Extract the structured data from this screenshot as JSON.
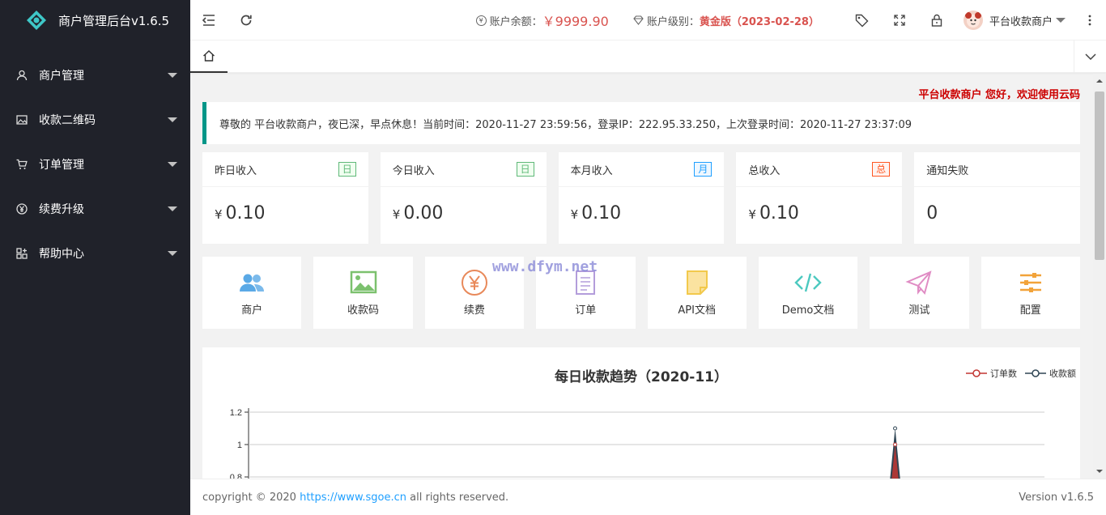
{
  "app": {
    "title": "商户管理后台v1.6.5"
  },
  "sidebar": {
    "items": [
      {
        "label": "商户管理",
        "icon": "user-icon"
      },
      {
        "label": "收款二维码",
        "icon": "image-icon"
      },
      {
        "label": "订单管理",
        "icon": "cart-icon"
      },
      {
        "label": "续费升级",
        "icon": "yen-icon"
      },
      {
        "label": "帮助中心",
        "icon": "apps-icon"
      }
    ]
  },
  "header": {
    "balance_label": "账户余额：",
    "balance_value": "￥9999.90",
    "level_label": "账户级别：",
    "level_value": "黄金版（2023-02-28）",
    "username": "平台收款商户"
  },
  "notice": {
    "marquee": "平台收款商户 您好，欢迎使用云码",
    "text": "尊敬的 平台收款商户，夜已深，早点休息！当前时间：2020-11-27 23:59:56，登录IP：222.95.33.250，上次登录时间：2020-11-27 23:37:09"
  },
  "stats": [
    {
      "title": "昨日收入",
      "badge": "日",
      "badge_color": "#5FB878",
      "currency": "¥",
      "value": "0.10"
    },
    {
      "title": "今日收入",
      "badge": "日",
      "badge_color": "#5FB878",
      "currency": "¥",
      "value": "0.00"
    },
    {
      "title": "本月收入",
      "badge": "月",
      "badge_color": "#1E9FFF",
      "currency": "¥",
      "value": "0.10"
    },
    {
      "title": "总收入",
      "badge": "总",
      "badge_color": "#FF5722",
      "currency": "¥",
      "value": "0.10"
    },
    {
      "title": "通知失败",
      "badge": "",
      "currency": "",
      "value": "0"
    }
  ],
  "shortcuts": [
    {
      "label": "商户",
      "icon": "users-icon",
      "color": "#5aa9e6"
    },
    {
      "label": "收款码",
      "icon": "picture-icon",
      "color": "#7cc16e"
    },
    {
      "label": "续费",
      "icon": "yen-circle-icon",
      "color": "#e8895a"
    },
    {
      "label": "订单",
      "icon": "document-icon",
      "color": "#b39ddb"
    },
    {
      "label": "API文档",
      "icon": "note-icon",
      "color": "#f2c94c"
    },
    {
      "label": "Demo文档",
      "icon": "code-icon",
      "color": "#4cc9c0"
    },
    {
      "label": "测试",
      "icon": "paper-plane-icon",
      "color": "#e08cc4"
    },
    {
      "label": "配置",
      "icon": "sliders-icon",
      "color": "#f2a33a"
    }
  ],
  "watermark": "www.dfym.net",
  "chart_data": {
    "type": "line",
    "title": "每日收款趋势（2020-11）",
    "xlabel": "",
    "ylabel": "",
    "ylim": [
      0.8,
      1.2
    ],
    "y_ticks": [
      "1.2",
      "1",
      "0.8"
    ],
    "series": [
      {
        "name": "订单数",
        "color": "#c23531",
        "peak_day": 27,
        "peak_value": 1
      },
      {
        "name": "收款额",
        "color": "#2f4554",
        "peak_day": 27,
        "peak_value": 1.1
      }
    ],
    "grid": true,
    "legend": "top-right"
  },
  "footer": {
    "copyright_prefix": "copyright © 2020 ",
    "link": "https://www.sgoe.cn",
    "copyright_suffix": " all rights reserved.",
    "version": "Version v1.6.5"
  }
}
